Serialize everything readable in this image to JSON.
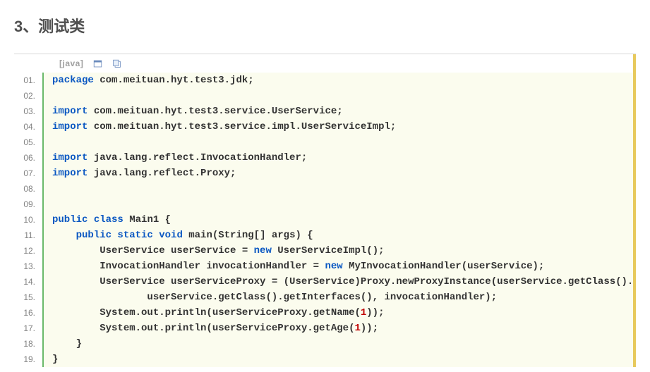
{
  "heading": "3、测试类",
  "toolbar": {
    "lang_label": "[java]",
    "view_icon": "view-plain-icon",
    "copy_icon": "copy-icon"
  },
  "code": {
    "language": "java",
    "lines": [
      {
        "n": "01",
        "tokens": [
          {
            "t": "package ",
            "c": "kw"
          },
          {
            "t": "com.meituan.hyt.test3.jdk;  ",
            "c": "plain"
          }
        ]
      },
      {
        "n": "02",
        "tokens": [
          {
            "t": "  ",
            "c": "plain"
          }
        ]
      },
      {
        "n": "03",
        "tokens": [
          {
            "t": "import ",
            "c": "kw"
          },
          {
            "t": "com.meituan.hyt.test3.service.UserService;  ",
            "c": "plain"
          }
        ]
      },
      {
        "n": "04",
        "tokens": [
          {
            "t": "import ",
            "c": "kw"
          },
          {
            "t": "com.meituan.hyt.test3.service.impl.UserServiceImpl;  ",
            "c": "plain"
          }
        ]
      },
      {
        "n": "05",
        "tokens": [
          {
            "t": "  ",
            "c": "plain"
          }
        ]
      },
      {
        "n": "06",
        "tokens": [
          {
            "t": "import ",
            "c": "kw"
          },
          {
            "t": "java.lang.reflect.InvocationHandler;  ",
            "c": "plain"
          }
        ]
      },
      {
        "n": "07",
        "tokens": [
          {
            "t": "import ",
            "c": "kw"
          },
          {
            "t": "java.lang.reflect.Proxy;  ",
            "c": "plain"
          }
        ]
      },
      {
        "n": "08",
        "tokens": [
          {
            "t": "  ",
            "c": "plain"
          }
        ]
      },
      {
        "n": "09",
        "tokens": [
          {
            "t": "  ",
            "c": "plain"
          }
        ]
      },
      {
        "n": "10",
        "tokens": [
          {
            "t": "public ",
            "c": "kw"
          },
          {
            "t": "class ",
            "c": "kw"
          },
          {
            "t": "Main1 {  ",
            "c": "plain"
          }
        ]
      },
      {
        "n": "11",
        "tokens": [
          {
            "t": "    ",
            "c": "plain"
          },
          {
            "t": "public ",
            "c": "kw"
          },
          {
            "t": "static ",
            "c": "kw"
          },
          {
            "t": "void ",
            "c": "kw"
          },
          {
            "t": "main(String[] args) {  ",
            "c": "plain"
          }
        ]
      },
      {
        "n": "12",
        "tokens": [
          {
            "t": "        UserService userService = ",
            "c": "plain"
          },
          {
            "t": "new ",
            "c": "kw"
          },
          {
            "t": "UserServiceImpl();  ",
            "c": "plain"
          }
        ]
      },
      {
        "n": "13",
        "tokens": [
          {
            "t": "        InvocationHandler invocationHandler = ",
            "c": "plain"
          },
          {
            "t": "new ",
            "c": "kw"
          },
          {
            "t": "MyInvocationHandler(userService);  ",
            "c": "plain"
          }
        ]
      },
      {
        "n": "14",
        "tokens": [
          {
            "t": "        UserService userServiceProxy = (UserService)Proxy.newProxyInstance(userService.getClass().getClassLoader(),  ",
            "c": "plain"
          }
        ]
      },
      {
        "n": "15",
        "tokens": [
          {
            "t": "                userService.getClass().getInterfaces(), invocationHandler);  ",
            "c": "plain"
          }
        ]
      },
      {
        "n": "16",
        "tokens": [
          {
            "t": "        System.out.println(userServiceProxy.getName(",
            "c": "plain"
          },
          {
            "t": "1",
            "c": "num"
          },
          {
            "t": "));  ",
            "c": "plain"
          }
        ]
      },
      {
        "n": "17",
        "tokens": [
          {
            "t": "        System.out.println(userServiceProxy.getAge(",
            "c": "plain"
          },
          {
            "t": "1",
            "c": "num"
          },
          {
            "t": "));  ",
            "c": "plain"
          }
        ]
      },
      {
        "n": "18",
        "tokens": [
          {
            "t": "    }  ",
            "c": "plain"
          }
        ]
      },
      {
        "n": "19",
        "tokens": [
          {
            "t": "}  ",
            "c": "plain"
          }
        ]
      }
    ]
  }
}
